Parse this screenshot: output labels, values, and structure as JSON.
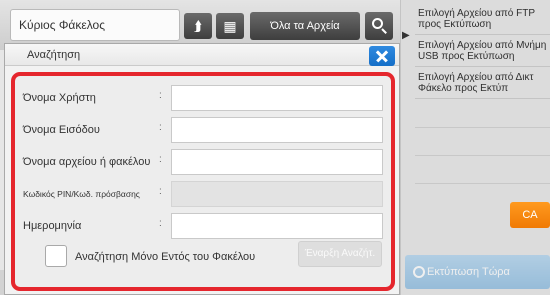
{
  "topbar": {
    "folder_title": "Κύριος Φάκελος",
    "filter_label": "Όλα τα Αρχεία",
    "up_icon": "arrow-up-icon",
    "view_icon": "grid-view-icon",
    "search_icon": "search-icon"
  },
  "sidebar": {
    "items": [
      {
        "label": "Επιλογή Αρχείου από FTP προς Εκτύπωση"
      },
      {
        "label": "Επιλογή Αρχείου από Μνήμη USB προς Εκτύπωση"
      },
      {
        "label": "Επιλογή Αρχείου από Δικτ Φάκελο προς Εκτύπ"
      }
    ],
    "ca_label": "CA",
    "print_label": "Εκτύπωση Τώρα",
    "accent_color": "#f28a11"
  },
  "dialog": {
    "title": "Αναζήτηση",
    "close_icon": "close-icon",
    "fields": [
      {
        "label": "Όνομα Χρήστη",
        "colon": ":",
        "value": "",
        "disabled": false
      },
      {
        "label": "Όνομα Εισόδου",
        "colon": ":",
        "value": "",
        "disabled": false
      },
      {
        "label": "Όνομα αρχείου ή φακέλου",
        "colon": ":",
        "value": "",
        "disabled": false
      },
      {
        "label": "Κωδικός PIN/Κωδ. πρόσβασης",
        "colon": ":",
        "value": "",
        "disabled": true
      },
      {
        "label": "Ημερομηνία",
        "colon": ":",
        "value": "",
        "disabled": false
      }
    ],
    "checkbox_label": "Αναζήτηση Μόνο Εντός του Φακέλου",
    "checkbox_checked": false,
    "start_button": "Έναρξη Αναζήτ.",
    "highlight_color": "#e5262d"
  }
}
